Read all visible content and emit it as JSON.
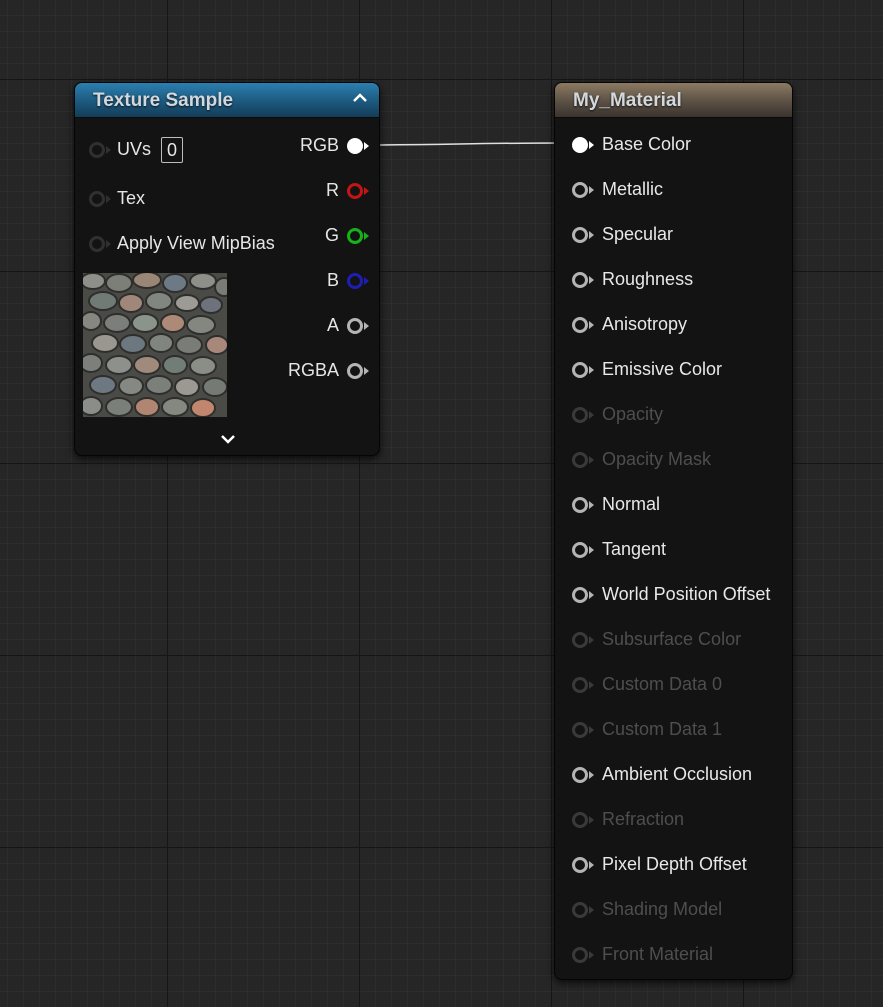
{
  "texture_node": {
    "title": "Texture Sample",
    "inputs": [
      {
        "label": "UVs",
        "value": "0"
      },
      {
        "label": "Tex"
      },
      {
        "label": "Apply View MipBias"
      }
    ],
    "outputs": [
      {
        "label": "RGB",
        "color": "#ffffff"
      },
      {
        "label": "R",
        "color": "#c41414"
      },
      {
        "label": "G",
        "color": "#17b217"
      },
      {
        "label": "B",
        "color": "#1e1eb4"
      },
      {
        "label": "A",
        "color": "#b4b4b4"
      },
      {
        "label": "RGBA",
        "color": "#b4b4b4"
      }
    ],
    "header_color": "#1b5579"
  },
  "material_node": {
    "title": "My_Material",
    "header_color": "#5b5045",
    "inputs": [
      {
        "label": "Base Color",
        "enabled": true,
        "connected": true
      },
      {
        "label": "Metallic",
        "enabled": true
      },
      {
        "label": "Specular",
        "enabled": true
      },
      {
        "label": "Roughness",
        "enabled": true
      },
      {
        "label": "Anisotropy",
        "enabled": true
      },
      {
        "label": "Emissive Color",
        "enabled": true
      },
      {
        "label": "Opacity",
        "enabled": false
      },
      {
        "label": "Opacity Mask",
        "enabled": false
      },
      {
        "label": "Normal",
        "enabled": true
      },
      {
        "label": "Tangent",
        "enabled": true
      },
      {
        "label": "World Position Offset",
        "enabled": true
      },
      {
        "label": "Subsurface Color",
        "enabled": false
      },
      {
        "label": "Custom Data 0",
        "enabled": false
      },
      {
        "label": "Custom Data 1",
        "enabled": false
      },
      {
        "label": "Ambient Occlusion",
        "enabled": true
      },
      {
        "label": "Refraction",
        "enabled": false
      },
      {
        "label": "Pixel Depth Offset",
        "enabled": true
      },
      {
        "label": "Shading Model",
        "enabled": false
      },
      {
        "label": "Front Material",
        "enabled": false
      }
    ]
  },
  "connection": {
    "from": "RGB",
    "to": "Base Color"
  }
}
